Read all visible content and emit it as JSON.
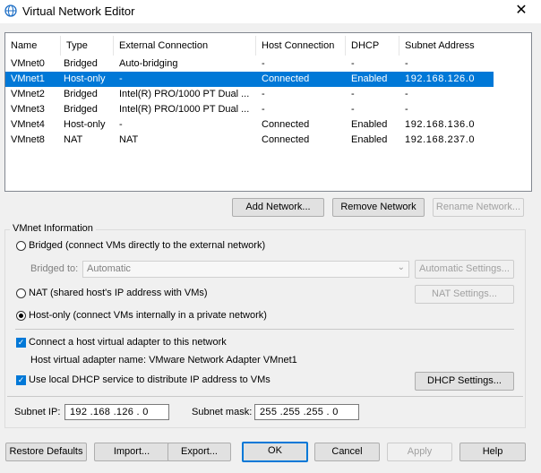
{
  "window": {
    "title": "Virtual Network Editor",
    "close_glyph": "✕",
    "icon": "globe-icon"
  },
  "table": {
    "columns": [
      "Name",
      "Type",
      "External Connection",
      "Host Connection",
      "DHCP",
      "Subnet Address"
    ],
    "rows": [
      [
        "VMnet0",
        "Bridged",
        "Auto-bridging",
        "-",
        "-",
        "-"
      ],
      [
        "VMnet1",
        "Host-only",
        "-",
        "Connected",
        "Enabled",
        "192.168.126.0"
      ],
      [
        "VMnet2",
        "Bridged",
        "Intel(R) PRO/1000 PT Dual ...",
        "-",
        "-",
        "-"
      ],
      [
        "VMnet3",
        "Bridged",
        "Intel(R) PRO/1000 PT Dual ...",
        "-",
        "-",
        "-"
      ],
      [
        "VMnet4",
        "Host-only",
        "-",
        "Connected",
        "Enabled",
        "192.168.136.0"
      ],
      [
        "VMnet8",
        "NAT",
        "NAT",
        "Connected",
        "Enabled",
        "192.168.237.0"
      ]
    ],
    "selected_row": 1
  },
  "network_buttons": {
    "add": "Add Network...",
    "remove": "Remove Network",
    "rename": "Rename Network..."
  },
  "vmnet_info": {
    "group_title": "VMnet Information",
    "bridged_label": "Bridged (connect VMs directly to the external network)",
    "bridged_to_label": "Bridged to:",
    "bridged_to_value": "Automatic",
    "automatic_settings": "Automatic Settings...",
    "nat_label": "NAT (shared host's IP address with VMs)",
    "nat_settings": "NAT Settings...",
    "hostonly_label": "Host-only (connect VMs internally in a private network)",
    "selected_mode": "host-only",
    "connect_adapter_label": "Connect a host virtual adapter to this network",
    "connect_adapter_checked": true,
    "adapter_name_text": "Host virtual adapter name: VMware Network Adapter VMnet1",
    "dhcp_label": "Use local DHCP service to distribute IP address to VMs",
    "dhcp_checked": true,
    "dhcp_settings": "DHCP Settings...",
    "subnet_ip_label": "Subnet IP:",
    "subnet_ip": "192 .168 .126 .  0",
    "subnet_mask_label": "Subnet mask:",
    "subnet_mask": "255 .255 .255 .  0"
  },
  "footer": {
    "restore": "Restore Defaults",
    "import": "Import...",
    "export": "Export...",
    "ok": "OK",
    "cancel": "Cancel",
    "apply": "Apply",
    "help": "Help"
  },
  "colors": {
    "selection": "#0078d7",
    "accent": "#0078d7"
  }
}
